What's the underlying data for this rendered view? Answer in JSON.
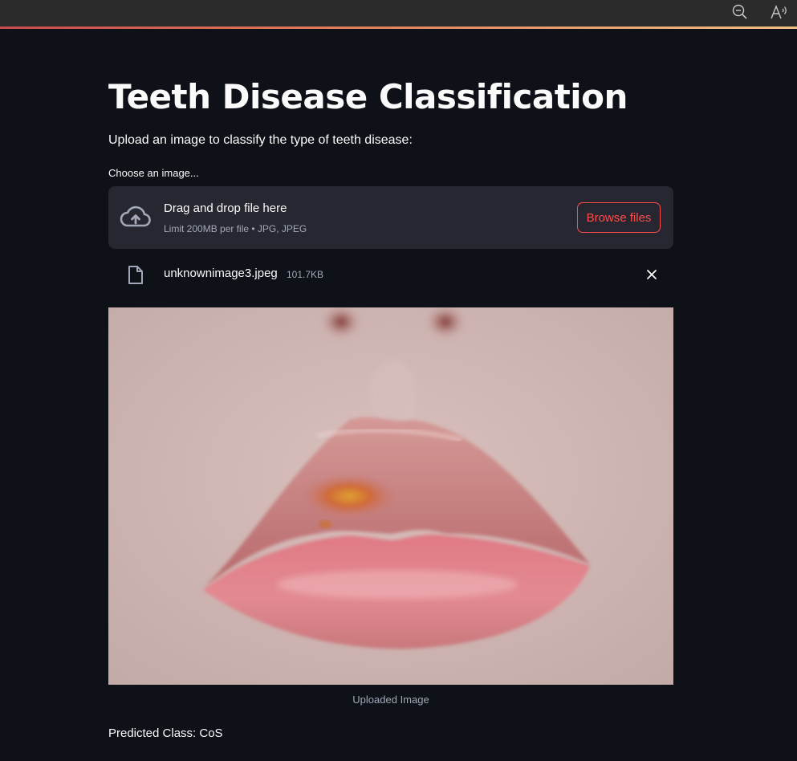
{
  "browser": {
    "zoom_icon": "zoom-out-icon",
    "read_aloud_icon": "read-aloud-icon"
  },
  "page": {
    "title": "Teeth Disease Classification",
    "subtitle": "Upload an image to classify the type of teeth disease:"
  },
  "uploader": {
    "label": "Choose an image...",
    "drop_title": "Drag and drop file here",
    "limit_text": "Limit 200MB per file • JPG, JPEG",
    "browse_label": "Browse files",
    "upload_icon": "cloud-upload-icon"
  },
  "file": {
    "name": "unknownimage3.jpeg",
    "size": "101.7KB",
    "file_icon": "file-icon",
    "remove_icon": "close-icon"
  },
  "image": {
    "caption": "Uploaded Image"
  },
  "result": {
    "prediction": "Predicted Class: CoS"
  },
  "colors": {
    "background": "#0e1117",
    "dropzone": "#262730",
    "accent": "#ff4b4b",
    "text": "#fafafa",
    "muted": "#a3a8b8"
  }
}
